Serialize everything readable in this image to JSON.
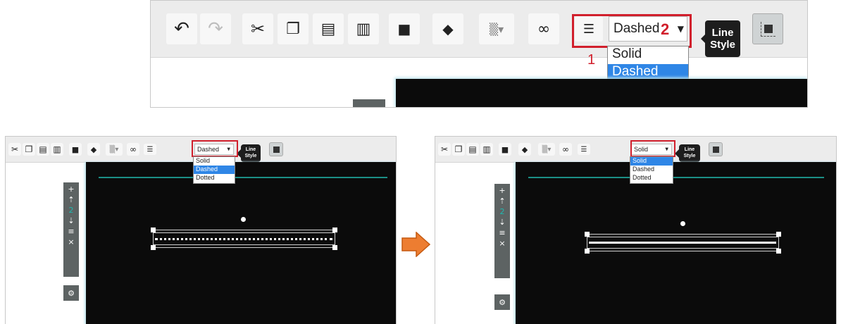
{
  "toolbar_icons": [
    "undo-icon",
    "redo-icon",
    "cut-icon",
    "copy-icon",
    "paste-icon",
    "delete-icon",
    "lock-icon",
    "fill-color-icon",
    "pattern-icon",
    "link-icon",
    "line-style-icon",
    "border-icon"
  ],
  "line_style": {
    "top_selected": "Dashed",
    "left_selected": "Dashed",
    "right_selected": "Solid",
    "options": [
      "Solid",
      "Dashed",
      "Dotted"
    ]
  },
  "tooltip": {
    "line1": "Line",
    "line2": "Style"
  },
  "callouts": {
    "one": "1",
    "two": "2"
  },
  "side_panel": {
    "page_number": "2"
  },
  "colors": {
    "highlight_red": "#d11f2c",
    "selected_blue": "#2f86e6",
    "arrow_orange": "#ed7d31",
    "teal_guide": "#1b8f86"
  }
}
